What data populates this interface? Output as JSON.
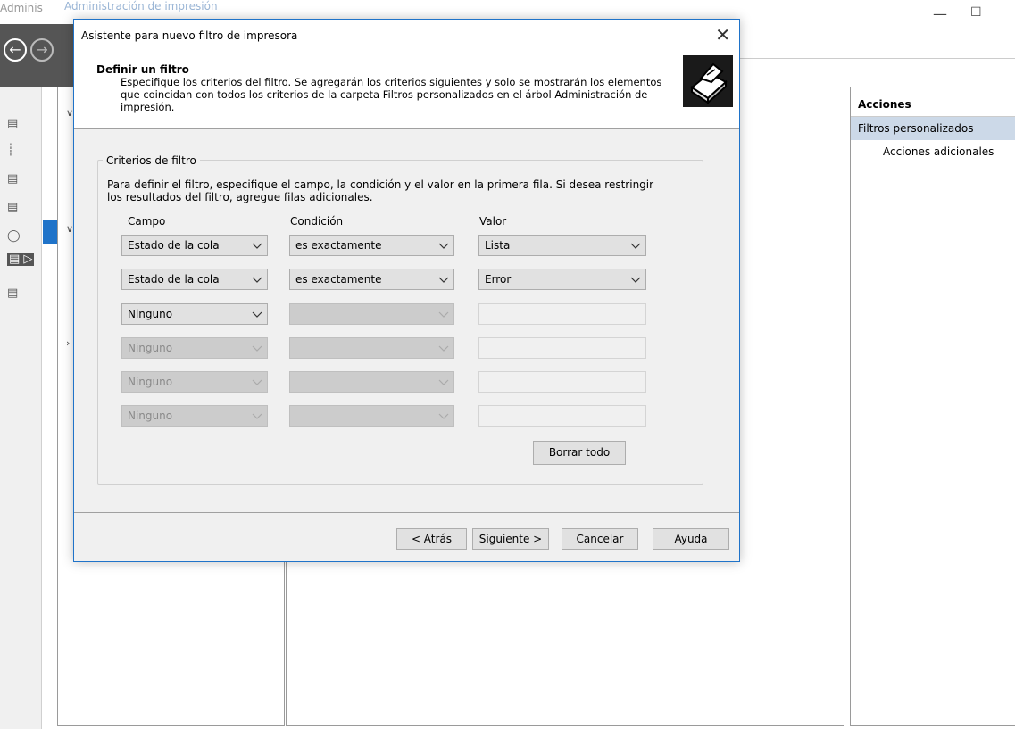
{
  "background_window": {
    "title": "Administración de impresión",
    "titlebar_left_fragment": "Adminis",
    "actions": {
      "header": "Acciones",
      "selected": "Filtros personalizados",
      "item": "Acciones adicionales"
    }
  },
  "dialog": {
    "title": "Asistente para nuevo filtro de impresora",
    "header_title": "Definir un filtro",
    "header_desc": "Especifique los criterios del filtro. Se agregarán los criterios siguientes y solo se mostrarán los elementos que coincidan con todos los criterios de la carpeta Filtros personalizados en el árbol Administración de impresión.",
    "group_label": "Criterios de filtro",
    "group_desc": "Para definir el filtro, especifique el campo, la condición y el valor en la primera fila. Si desea restringir los resultados del filtro, agregue filas adicionales.",
    "columns": {
      "campo": "Campo",
      "condicion": "Condición",
      "valor": "Valor"
    },
    "rows": [
      {
        "campo": "Estado de la cola",
        "condicion": "es exactamente",
        "valor": "Lista"
      },
      {
        "campo": "Estado de la cola",
        "condicion": "es exactamente",
        "valor": "Error"
      },
      {
        "campo": "Ninguno",
        "condicion": "",
        "valor": ""
      },
      {
        "campo": "Ninguno",
        "condicion": "",
        "valor": ""
      },
      {
        "campo": "Ninguno",
        "condicion": "",
        "valor": ""
      },
      {
        "campo": "Ninguno",
        "condicion": "",
        "valor": ""
      }
    ],
    "buttons": {
      "clear_all": "Borrar todo",
      "back": "< Atrás",
      "next": "Siguiente >",
      "cancel": "Cancelar",
      "help": "Ayuda"
    }
  }
}
